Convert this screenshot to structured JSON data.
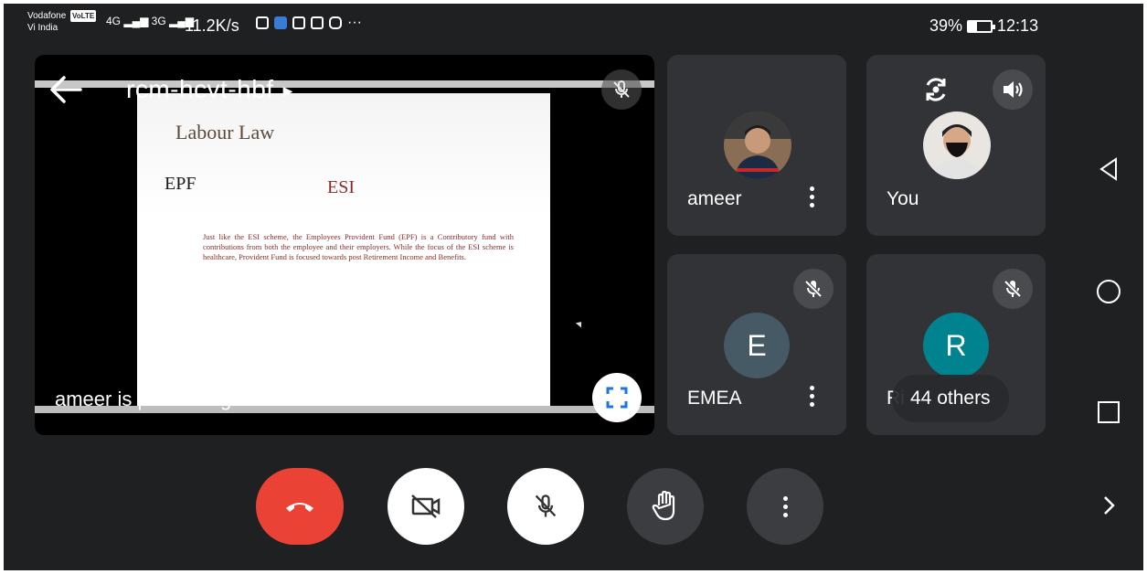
{
  "status_bar": {
    "carrier": "Vodafone",
    "volte": "VoLTE",
    "carrier_sub": "Vi India",
    "network_1": "4G",
    "network_2": "3G",
    "speed": "11.2K/s",
    "extra_dots": "···",
    "battery": "39%",
    "battery_level": 0.39,
    "time": "12:13"
  },
  "presentation": {
    "meeting_code": "rcm-hcvt-hbf",
    "presenter_caption": "ameer is presenting",
    "slide": {
      "title": "Labour Law",
      "left_heading": "EPF",
      "right_heading": "ESI",
      "body": "Just like the ESI scheme, the Employees Provident Fund (EPF) is a Contributory fund with contributions from both the employee and their employers. While the focus of the ESI scheme is healthcare, Provident Fund is focused towards post Retirement Income and Benefits."
    }
  },
  "participants": [
    {
      "name": "ameer",
      "type": "photo",
      "muted": false
    },
    {
      "name": "You",
      "type": "photo",
      "muted": false
    },
    {
      "name": "EMEA",
      "initial": "E",
      "avatar_color": "#455a64",
      "muted": true
    },
    {
      "name": "Ri",
      "initial": "R",
      "avatar_color": "#00838f",
      "muted": true
    }
  ],
  "others_chip": "44 others",
  "colors": {
    "end_call": "#ea4335",
    "control_white": "#ffffff",
    "control_dark": "#3c3d40",
    "tile_bg": "#323336",
    "background": "#1f2022"
  },
  "icons": {
    "back": "arrow-left-icon",
    "mic_off": "mic-off-icon",
    "fullscreen": "fullscreen-icon",
    "camera_switch": "camera-switch-icon",
    "speaker": "speaker-icon",
    "end_call": "end-call-icon",
    "camera_off": "camera-off-icon",
    "raise_hand": "hand-icon",
    "more": "more-vertical-icon"
  }
}
